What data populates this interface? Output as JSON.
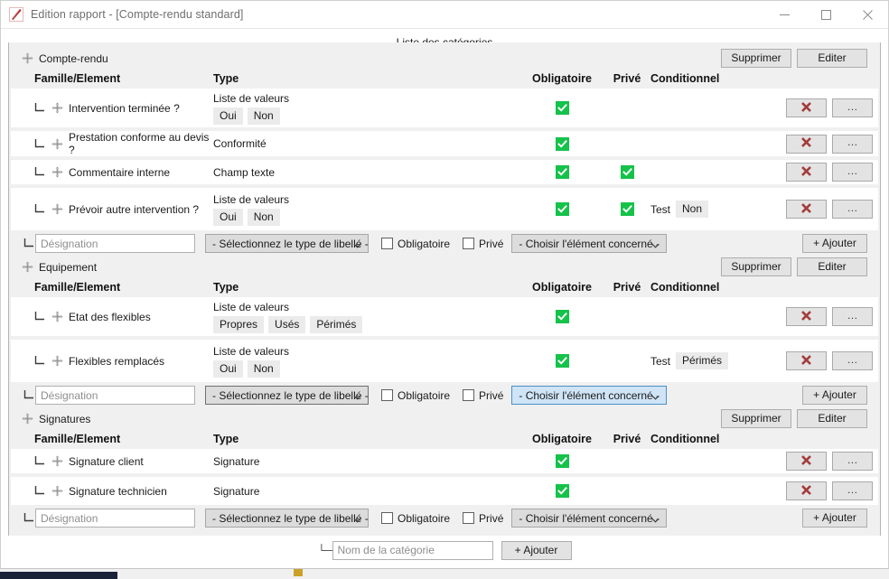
{
  "window": {
    "title": "Edition rapport - [Compte-rendu standard]",
    "icon": "pen-icon",
    "minimize_label": "—",
    "maximize_label": "□",
    "close_label": "✕"
  },
  "group": {
    "legend": "Liste des catégories"
  },
  "columns": {
    "famille": "Famille/Element",
    "type": "Type",
    "obligatoire": "Obligatoire",
    "prive": "Privé",
    "conditionnel": "Conditionnel"
  },
  "common": {
    "supprimer": "Supprimer",
    "editer": "Editer",
    "ajouter": "+ Ajouter",
    "dots": "…",
    "designation_placeholder": "Désignation",
    "select_libelle": "- Sélectionnez le type de libellé -",
    "select_element": "- Choisir l'élément concerné -",
    "obligatoire_label": "Obligatoire",
    "prive_label": "Privé",
    "test_label": "Test",
    "tree_branch": "└─",
    "move_icon": "move-handle-icon",
    "delete_icon": "red-x-icon"
  },
  "bottom": {
    "category_placeholder": "Nom de la catégorie",
    "add_label": "+ Ajouter"
  },
  "colors": {
    "check_green": "#15c24a",
    "delete_red": "#a33b3b",
    "accent_blue": "#4a90c4"
  },
  "categories": [
    {
      "name": "Compte-rendu",
      "rows": [
        {
          "label": "Intervention terminée ?",
          "type": "Liste de valeurs",
          "values": [
            "Oui",
            "Non"
          ],
          "obligatoire": true,
          "prive": false,
          "conditional": null
        },
        {
          "label": "Prestation conforme au devis ?",
          "type": "Conformité",
          "values": [],
          "obligatoire": true,
          "prive": false,
          "conditional": null
        },
        {
          "label": "Commentaire interne",
          "type": "Champ texte",
          "values": [],
          "obligatoire": true,
          "prive": true,
          "conditional": null
        },
        {
          "label": "Prévoir autre intervention ?",
          "type": "Liste de valeurs",
          "values": [
            "Oui",
            "Non"
          ],
          "obligatoire": true,
          "prive": true,
          "conditional": "Non"
        }
      ],
      "form": {
        "designation_value": "",
        "libelle_selected": "- Sélectionnez le type de libellé -",
        "element_selected": "- Choisir l'élément concerné -",
        "obligatoire_checked": false,
        "prive_checked": false,
        "libelle_state": "normal",
        "element_state": "normal"
      }
    },
    {
      "name": "Equipement",
      "rows": [
        {
          "label": "Etat des flexibles",
          "type": "Liste de valeurs",
          "values": [
            "Propres",
            "Usés",
            "Périmés"
          ],
          "obligatoire": true,
          "prive": false,
          "conditional": null
        },
        {
          "label": "Flexibles remplacés",
          "type": "Liste de valeurs",
          "values": [
            "Oui",
            "Non"
          ],
          "obligatoire": true,
          "prive": false,
          "conditional": "Périmés"
        }
      ],
      "form": {
        "designation_value": "",
        "libelle_selected": "- Sélectionnez le type de libellé -",
        "element_selected": "- Choisir l'élément concerné -",
        "obligatoire_checked": false,
        "prive_checked": false,
        "libelle_state": "focus",
        "element_state": "active"
      }
    },
    {
      "name": "Signatures",
      "rows": [
        {
          "label": "Signature client",
          "type": "Signature",
          "values": [],
          "obligatoire": true,
          "prive": false,
          "conditional": null
        },
        {
          "label": "Signature technicien",
          "type": "Signature",
          "values": [],
          "obligatoire": true,
          "prive": false,
          "conditional": null
        }
      ],
      "form": {
        "designation_value": "",
        "libelle_selected": "- Sélectionnez le type de libellé -",
        "element_selected": "- Choisir l'élément concerné -",
        "obligatoire_checked": false,
        "prive_checked": false,
        "libelle_state": "normal",
        "element_state": "normal"
      }
    }
  ]
}
